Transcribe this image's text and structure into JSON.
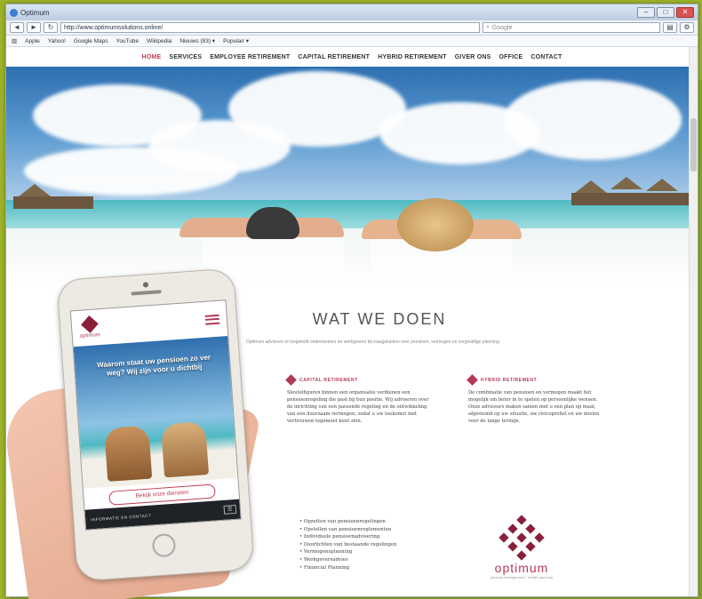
{
  "browser": {
    "window_title": "Optimum",
    "url": "http://www.optimumsolutions.online/",
    "search_placeholder": "Google",
    "back": "◄",
    "forward": "►",
    "reload": "↻",
    "bookmarks": [
      "Apple",
      "Yahoo!",
      "Google Maps",
      "YouTube",
      "Wikipedia",
      "Nieuws (83) ▾",
      "Populair ▾"
    ]
  },
  "site_nav": {
    "items": [
      "HOME",
      "SERVICES",
      "EMPLOYEE RETIREMENT",
      "CAPITAL RETIREMENT",
      "HYBRID RETIREMENT",
      "GIVER ONS",
      "OFFICE",
      "CONTACT"
    ],
    "active": "HOME"
  },
  "section": {
    "title": "WAT WE DOEN",
    "intro": "Optimum adviseert en begeleidt ondernemers en werkgevers bij vraagstukken over pensioen, vermogen en zorgvuldige planning."
  },
  "columns": [
    {
      "heading": "CAPITAL RETIREMENT",
      "text": "Sleutelfiguren binnen een organisatie verdienen een pensioenregeling die past bij hun positie. Wij adviseren over de inrichting van een passende regeling en de ontwikkeling van een duurzaam vermogen, zodat u uw toekomst met vertrouwen tegemoet kunt zien."
    },
    {
      "heading": "HYBRID RETIREMENT",
      "text": "De combinatie van pensioen en vermogen maakt het mogelijk om beter in te spelen op persoonlijke wensen. Onze adviseurs maken samen met u een plan op maat, afgestemd op uw situatie, uw risicoprofiel en uw doelen voor de lange termijn."
    }
  ],
  "bullets": [
    "• Opzetten van pensioenregelingen",
    "• Opstellen van pensioenreglementen",
    "• Individuele pensioenadvisering",
    "• Doorlichten van bestaande regelingen",
    "• Vermogensplanning",
    "• Werkgeversadvies",
    "• Financial Planning"
  ],
  "logo": {
    "word": "optimum",
    "sub": "pension management · wealth planning"
  },
  "mobile": {
    "logo_word": "optimum",
    "headline": "Waarom staat uw pensioen zo ver weg? Wij zijn voor u dichtbij",
    "cta": "Bekijk onze diensten",
    "footer_text": "INFORMATIE EN CONTACT",
    "footer_button": "☰"
  },
  "colors": {
    "accent": "#c23b54",
    "logo_dark": "#8a1f3a",
    "frame": "#9cb22a"
  }
}
